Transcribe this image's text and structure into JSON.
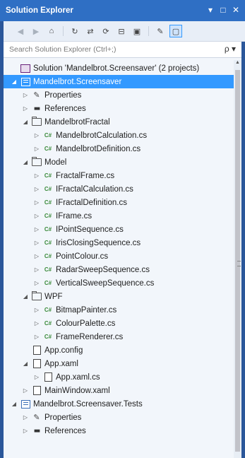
{
  "window": {
    "title": "Solution Explorer",
    "controls": [
      "▾",
      "□",
      "✕"
    ]
  },
  "toolbar": {
    "buttons": [
      "back",
      "forward",
      "home",
      "sync",
      "pending-changes",
      "refresh",
      "collapse-all",
      "show-all-files",
      "properties",
      "preview"
    ]
  },
  "search": {
    "placeholder": "Search Solution Explorer (Ctrl+;)",
    "icon_glyph": "ρ ▾"
  },
  "tree": [
    {
      "label": "Solution 'Mandelbrot.Screensaver' (2 projects)",
      "depth": 0,
      "icon": "solution",
      "chev": ""
    },
    {
      "label": "Mandelbrot.Screensaver",
      "depth": 0,
      "icon": "project",
      "chev": "expanded",
      "selected": true
    },
    {
      "label": "Properties",
      "depth": 1,
      "icon": "wrench",
      "chev": "collapsed"
    },
    {
      "label": "References",
      "depth": 1,
      "icon": "references",
      "chev": "collapsed"
    },
    {
      "label": "MandelbrotFractal",
      "depth": 1,
      "icon": "folder",
      "chev": "expanded"
    },
    {
      "label": "MandelbrotCalculation.cs",
      "depth": 2,
      "icon": "csharp",
      "chev": "collapsed"
    },
    {
      "label": "MandelbrotDefinition.cs",
      "depth": 2,
      "icon": "csharp",
      "chev": "collapsed"
    },
    {
      "label": "Model",
      "depth": 1,
      "icon": "folder",
      "chev": "expanded"
    },
    {
      "label": "FractalFrame.cs",
      "depth": 2,
      "icon": "csharp",
      "chev": "collapsed"
    },
    {
      "label": "IFractalCalculation.cs",
      "depth": 2,
      "icon": "csharp",
      "chev": "collapsed"
    },
    {
      "label": "IFractalDefinition.cs",
      "depth": 2,
      "icon": "csharp",
      "chev": "collapsed"
    },
    {
      "label": "IFrame.cs",
      "depth": 2,
      "icon": "csharp",
      "chev": "collapsed"
    },
    {
      "label": "IPointSequence.cs",
      "depth": 2,
      "icon": "csharp",
      "chev": "collapsed"
    },
    {
      "label": "IrisClosingSequence.cs",
      "depth": 2,
      "icon": "csharp",
      "chev": "collapsed"
    },
    {
      "label": "PointColour.cs",
      "depth": 2,
      "icon": "csharp",
      "chev": "collapsed"
    },
    {
      "label": "RadarSweepSequence.cs",
      "depth": 2,
      "icon": "csharp",
      "chev": "collapsed"
    },
    {
      "label": "VerticalSweepSequence.cs",
      "depth": 2,
      "icon": "csharp",
      "chev": "collapsed"
    },
    {
      "label": "WPF",
      "depth": 1,
      "icon": "folder",
      "chev": "expanded"
    },
    {
      "label": "BitmapPainter.cs",
      "depth": 2,
      "icon": "csharp",
      "chev": "collapsed"
    },
    {
      "label": "ColourPalette.cs",
      "depth": 2,
      "icon": "csharp",
      "chev": "collapsed"
    },
    {
      "label": "FrameRenderer.cs",
      "depth": 2,
      "icon": "csharp",
      "chev": "collapsed"
    },
    {
      "label": "App.config",
      "depth": 1,
      "icon": "document",
      "chev": ""
    },
    {
      "label": "App.xaml",
      "depth": 1,
      "icon": "document",
      "chev": "expanded"
    },
    {
      "label": "App.xaml.cs",
      "depth": 2,
      "icon": "document",
      "chev": "collapsed"
    },
    {
      "label": "MainWindow.xaml",
      "depth": 1,
      "icon": "document",
      "chev": "collapsed"
    },
    {
      "label": "Mandelbrot.Screensaver.Tests",
      "depth": 0,
      "icon": "project",
      "chev": "expanded"
    },
    {
      "label": "Properties",
      "depth": 1,
      "icon": "wrench",
      "chev": "collapsed"
    },
    {
      "label": "References",
      "depth": 1,
      "icon": "references",
      "chev": "collapsed"
    }
  ],
  "colors": {
    "title_bar": "#2f6fc4",
    "selection": "#3399ff",
    "panel_bg": "#f2f6fb",
    "csharp_icon": "#3a8a3a"
  }
}
